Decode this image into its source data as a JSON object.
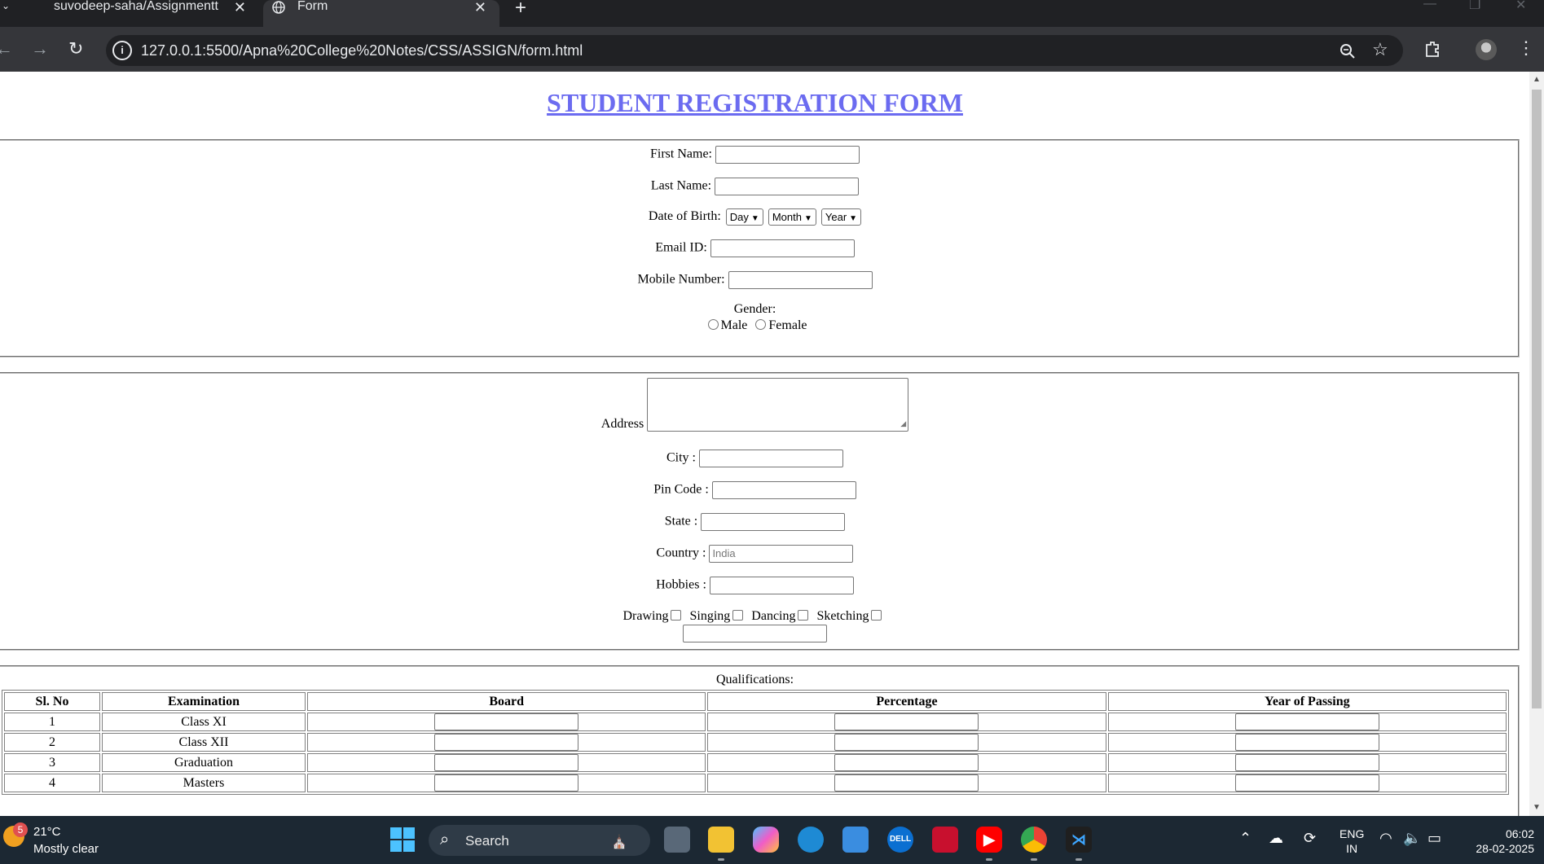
{
  "browser": {
    "tabs": [
      {
        "title": "suvodeep-saha/Assignmentt",
        "active": false
      },
      {
        "title": "Form",
        "active": true
      }
    ],
    "url": "127.0.0.1:5500/Apna%20College%20Notes/CSS/ASSIGN/form.html"
  },
  "page": {
    "title": "STUDENT REGISTRATION FORM",
    "title_color": "#6b6bf0",
    "personal": {
      "first_name_label": "First Name:",
      "last_name_label": "Last Name:",
      "dob_label": "Date of Birth:",
      "dob_day": "Day",
      "dob_month": "Month",
      "dob_year": "Year",
      "email_label": "Email ID:",
      "mobile_label": "Mobile Number:",
      "gender_label": "Gender:",
      "male_label": "Male",
      "female_label": "Female"
    },
    "address": {
      "address_label": "Address",
      "city_label": "City :",
      "pin_label": "Pin Code :",
      "state_label": "State :",
      "country_label": "Country :",
      "country_placeholder": "India",
      "hobbies_label": "Hobbies :",
      "hobby_options": [
        "Drawing",
        "Singing",
        "Dancing",
        "Sketching"
      ]
    },
    "qualifications": {
      "caption": "Qualifications:",
      "headers": [
        "Sl. No",
        "Examination",
        "Board",
        "Percentage",
        "Year of Passing"
      ],
      "rows": [
        {
          "sl": "1",
          "exam": "Class XI"
        },
        {
          "sl": "2",
          "exam": "Class XII"
        },
        {
          "sl": "3",
          "exam": "Graduation"
        },
        {
          "sl": "4",
          "exam": "Masters"
        }
      ]
    }
  },
  "taskbar": {
    "weather_badge": "5",
    "weather_temp": "21°C",
    "weather_desc": "Mostly clear",
    "search_label": "Search",
    "lang_top": "ENG",
    "lang_bottom": "IN",
    "time": "06:02",
    "date": "28-02-2025"
  }
}
